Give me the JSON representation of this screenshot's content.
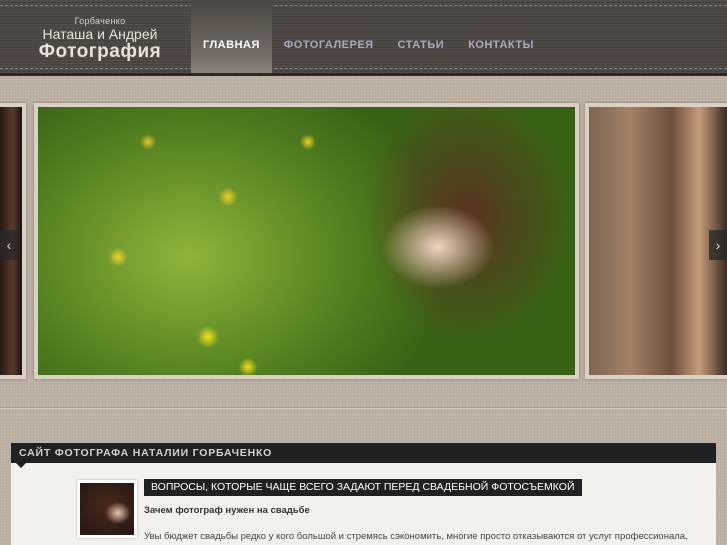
{
  "logo": {
    "small": "Горбаченко",
    "names": "Наташа и Андрей",
    "title": "Фотография"
  },
  "nav": {
    "items": [
      {
        "label": "ГЛАВНАЯ",
        "active": true
      },
      {
        "label": "ФОТОГАЛЕРЕЯ",
        "active": false
      },
      {
        "label": "СТАТЬИ",
        "active": false
      },
      {
        "label": "КОНТАКТЫ",
        "active": false
      }
    ]
  },
  "slider": {
    "prev_icon": "chevron-left-icon",
    "next_icon": "chevron-right-icon"
  },
  "section": {
    "title": "САЙТ ФОТОГРАФА НАТАЛИИ ГОРБАЧЕНКО"
  },
  "article": {
    "title": "ВОПРОСЫ, КОТОРЫЕ ЧАЩЕ ВСЕГО ЗАДАЮТ ПЕРЕД СВАДЕБНОЙ ФОТОСЪЕМКОЙ",
    "subtitle": "Зачем фотограф нужен на свадьбе",
    "text": "Увы бюджет свадьбы редко у кого большой и стремясь сэкономить, многие просто отказываются от услуг профессионала,"
  },
  "colors": {
    "header_bg": "#4a4440",
    "nav_text": "#a9a8c2",
    "panel_dark": "#1f2224",
    "page_bg": "#bdb2a4"
  }
}
